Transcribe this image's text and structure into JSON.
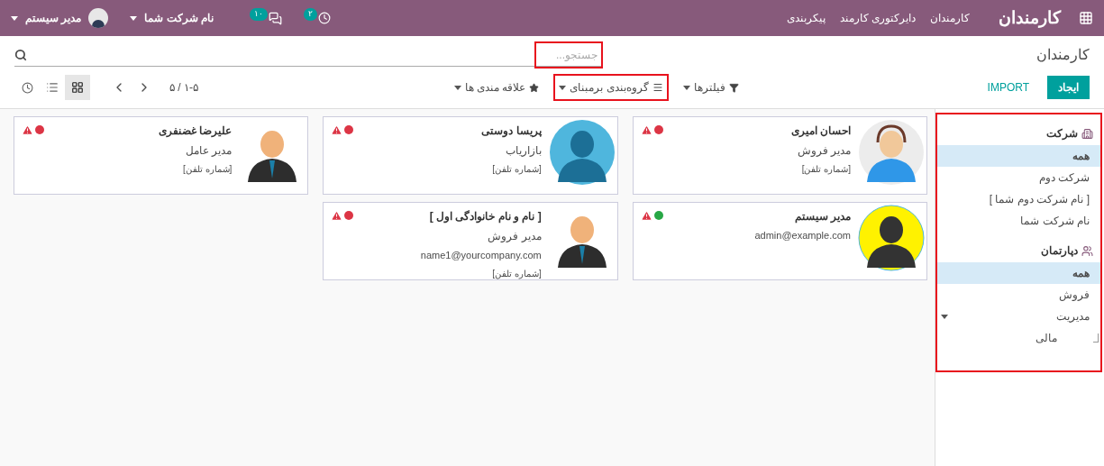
{
  "navbar": {
    "brand": "کارمندان",
    "menu": [
      "کارمندان",
      "دایرکتوری کارمند",
      "پیکربندی"
    ],
    "activity_count": "۲",
    "message_count": "۱۰",
    "company": "نام شرکت شما",
    "user": "مدیر سیستم"
  },
  "control_panel": {
    "breadcrumb": "کارمندان",
    "create_button": "ایجاد",
    "import_button": "IMPORT",
    "search": {
      "placeholder": "جستجو...",
      "highlighted": true
    },
    "search_options": [
      {
        "kind": "filter",
        "label": "فیلترها",
        "highlighted": false
      },
      {
        "kind": "groupby",
        "label": "گروه‌بندی برمبنای",
        "highlighted": true
      },
      {
        "kind": "favorites",
        "label": "علاقه مندی ها",
        "highlighted": false
      }
    ],
    "pager": "۱-۵ / ۵",
    "views": [
      {
        "kind": "kanban",
        "selected": true
      },
      {
        "kind": "list",
        "selected": false
      },
      {
        "kind": "activity",
        "selected": false
      }
    ]
  },
  "sidebar": {
    "highlighted": true,
    "sections": [
      {
        "kind": "company",
        "title": "شرکت",
        "items": [
          {
            "label": "همه",
            "selected": true
          },
          {
            "label": "شرکت دوم",
            "selected": false
          },
          {
            "label": "[ نام شرکت دوم شما ]",
            "selected": false
          },
          {
            "label": "نام شرکت شما",
            "selected": false
          }
        ]
      },
      {
        "kind": "department",
        "title": "دپارتمان",
        "items": [
          {
            "label": "همه",
            "selected": true
          },
          {
            "label": "فروش",
            "selected": false
          },
          {
            "label": "مدیریت",
            "selected": false,
            "expanded": true,
            "children": [
              {
                "label": "مالی",
                "selected": false
              }
            ]
          }
        ]
      }
    ]
  },
  "employees": [
    {
      "name": "احسان امیری",
      "job": "مدیر فروش",
      "phone": "[شماره تلفن]",
      "color": "#dc3545",
      "kind": "headset"
    },
    {
      "name": "پریسا دوستی",
      "job": "بازاریاب",
      "phone": "[شماره تلفن]",
      "color": "#dc3545",
      "kind": "hijab"
    },
    {
      "name": "علیرضا غضنفری",
      "job": "مدیر عامل",
      "phone": "[شماره تلفن]",
      "color": "#dc3545",
      "kind": "suit"
    },
    {
      "name": "مدیر سیستم",
      "email": "admin@example.com",
      "color": "#28a745",
      "kind": "admin"
    },
    {
      "name": "[ نام و نام خانوادگی اول ]",
      "job": "مدیر فروش",
      "email": "name1@yourcompany.com",
      "phone": "[شماره تلفن]",
      "color": "#dc3545",
      "kind": "suit"
    }
  ]
}
